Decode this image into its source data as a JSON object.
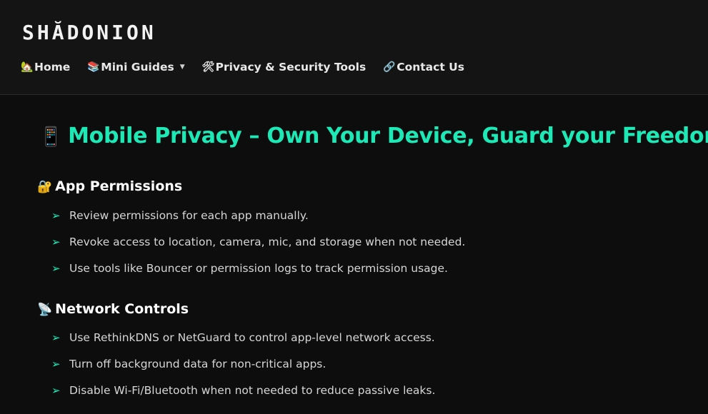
{
  "header": {
    "logo": "SHĂDONION",
    "nav": [
      {
        "icon": "🏡",
        "icon_name": "house-icon",
        "label": "Home"
      },
      {
        "icon": "📚",
        "icon_name": "books-icon",
        "label": "Mini Guides",
        "dropdown": true,
        "caret": "▼"
      },
      {
        "icon": "🛠",
        "icon_name": "tools-icon",
        "label": "Privacy & Security Tools"
      },
      {
        "icon": "🔗",
        "icon_name": "link-icon",
        "label": "Contact Us"
      }
    ]
  },
  "main": {
    "title_icon": "📱",
    "title": "Mobile Privacy – Own Your Device, Guard your Freedom",
    "bullet_glyph": "➢",
    "sections": [
      {
        "icon": "🔐",
        "icon_name": "lock-key-icon",
        "heading": "App Permissions",
        "items": [
          "Review permissions for each app manually.",
          "Revoke access to location, camera, mic, and storage when not needed.",
          "Use tools like Bouncer or permission logs to track permission usage."
        ]
      },
      {
        "icon": "📡",
        "icon_name": "satellite-dish-icon",
        "heading": "Network Controls",
        "items": [
          "Use RethinkDNS or NetGuard to control app-level network access.",
          "Turn off background data for non-critical apps.",
          "Disable Wi-Fi/Bluetooth when not needed to reduce passive leaks."
        ]
      }
    ]
  },
  "colors": {
    "accent": "#1de9b6",
    "background": "#0d0d0d",
    "header_background": "#141414",
    "text": "#d6d6d6"
  }
}
